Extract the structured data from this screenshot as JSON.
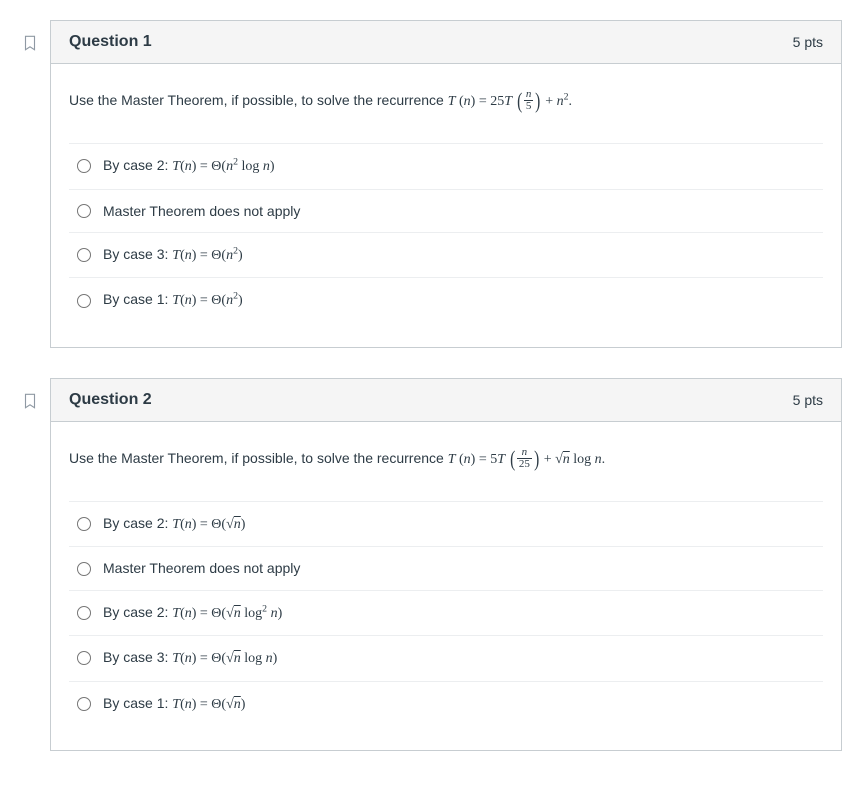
{
  "questions": [
    {
      "title": "Question 1",
      "points": "5 pts",
      "prompt_prefix": "Use the Master Theorem, if possible, to solve the recurrence ",
      "recurrence": {
        "coef": "25",
        "denom": "5",
        "tail_exp": "2"
      },
      "answers": [
        {
          "prefix": "By case 2: ",
          "type": "theta_n2logn"
        },
        {
          "prefix": "",
          "type": "no_apply",
          "text": "Master Theorem does not apply"
        },
        {
          "prefix": "By case 3: ",
          "type": "theta_n2"
        },
        {
          "prefix": "By case 1: ",
          "type": "theta_n2"
        }
      ]
    },
    {
      "title": "Question 2",
      "points": "5 pts",
      "prompt_prefix": "Use the Master Theorem, if possible, to solve the recurrence ",
      "recurrence": {
        "coef": "5",
        "denom": "25",
        "tail_type": "sqrtlog"
      },
      "answers": [
        {
          "prefix": "By case 2: ",
          "type": "theta_sqrt"
        },
        {
          "prefix": "",
          "type": "no_apply",
          "text": "Master Theorem does not apply"
        },
        {
          "prefix": "By case 2: ",
          "type": "theta_sqrt_log2"
        },
        {
          "prefix": "By case 3: ",
          "type": "theta_sqrt_log"
        },
        {
          "prefix": "By case 1: ",
          "type": "theta_sqrt"
        }
      ]
    }
  ]
}
